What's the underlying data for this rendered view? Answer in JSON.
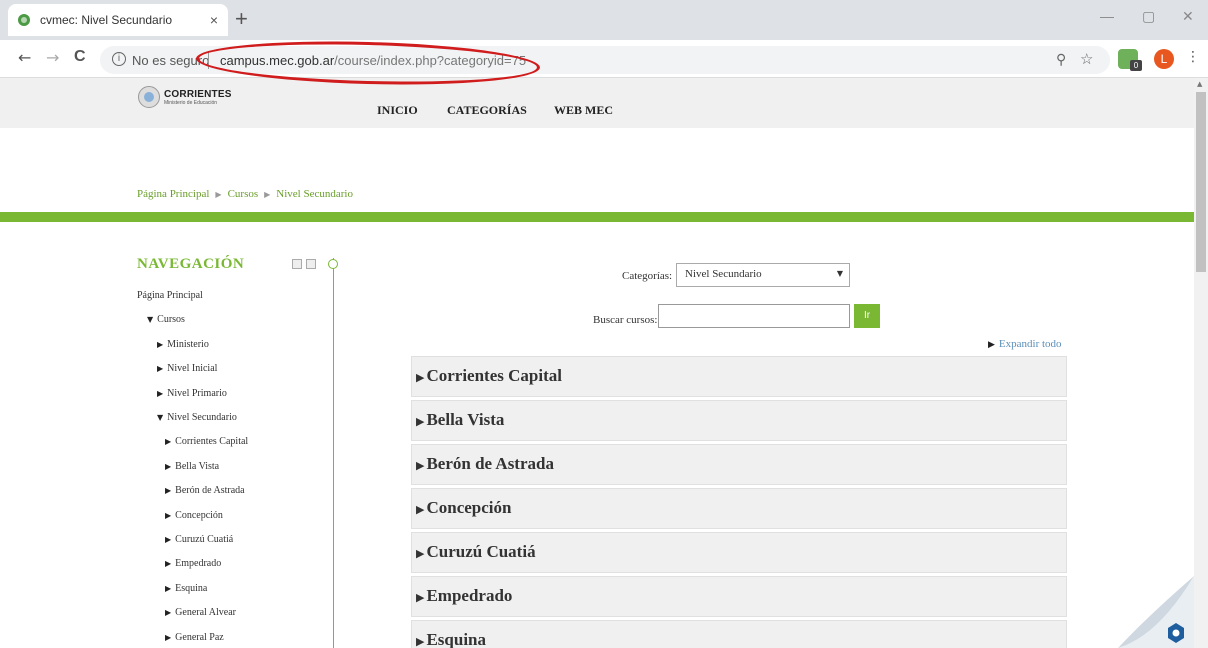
{
  "browser": {
    "tab_title": "cvmec: Nivel Secundario",
    "tab_close": "×",
    "new_tab": "+",
    "back": "←",
    "forward": "→",
    "reload": "C",
    "secure_label": "No es seguro",
    "url_host": "campus.mec.gob.ar",
    "url_path": "/course/index.php?categoryid=75",
    "ext_badge": "0",
    "avatar_letter": "L",
    "menu": "⋮",
    "minimize": "—",
    "restore": "▢",
    "close": "✕"
  },
  "site": {
    "logo_name": "CORRIENTES",
    "logo_sub": "Ministerio de Educación",
    "nav": [
      "INICIO",
      "CATEGORÍAS",
      "WEB MEC"
    ]
  },
  "breadcrumb": [
    "Página Principal",
    "Cursos",
    "Nivel Secundario"
  ],
  "sidebar": {
    "title": "NAVEGACIÓN",
    "items": [
      {
        "label": "Página Principal",
        "level": 0,
        "icon": ""
      },
      {
        "label": "Cursos",
        "level": 1,
        "icon": "▼"
      },
      {
        "label": "Ministerio",
        "level": 2,
        "icon": "▶"
      },
      {
        "label": "Nivel Inicial",
        "level": 2,
        "icon": "▶"
      },
      {
        "label": "Nivel Primario",
        "level": 2,
        "icon": "▶"
      },
      {
        "label": "Nivel Secundario",
        "level": 2,
        "icon": "▼"
      },
      {
        "label": "Corrientes Capital",
        "level": 3,
        "icon": "▶"
      },
      {
        "label": "Bella Vista",
        "level": 3,
        "icon": "▶"
      },
      {
        "label": "Berón de Astrada",
        "level": 3,
        "icon": "▶"
      },
      {
        "label": "Concepción",
        "level": 3,
        "icon": "▶"
      },
      {
        "label": "Curuzú Cuatiá",
        "level": 3,
        "icon": "▶"
      },
      {
        "label": "Empedrado",
        "level": 3,
        "icon": "▶"
      },
      {
        "label": "Esquina",
        "level": 3,
        "icon": "▶"
      },
      {
        "label": "General Alvear",
        "level": 3,
        "icon": "▶"
      },
      {
        "label": "General Paz",
        "level": 3,
        "icon": "▶"
      }
    ]
  },
  "main": {
    "categories_label": "Categorías:",
    "categories_selected": "Nivel Secundario",
    "search_label": "Buscar cursos:",
    "search_value": "",
    "go_label": "Ir",
    "expand_all": "Expandir todo",
    "categories": [
      "Corrientes Capital",
      "Bella Vista",
      "Berón de Astrada",
      "Concepción",
      "Curuzú Cuatiá",
      "Empedrado",
      "Esquina"
    ]
  },
  "colors": {
    "accent_green": "#7ab834",
    "annotation_red": "#d01c1c",
    "link_blue": "#5b8fb9"
  }
}
